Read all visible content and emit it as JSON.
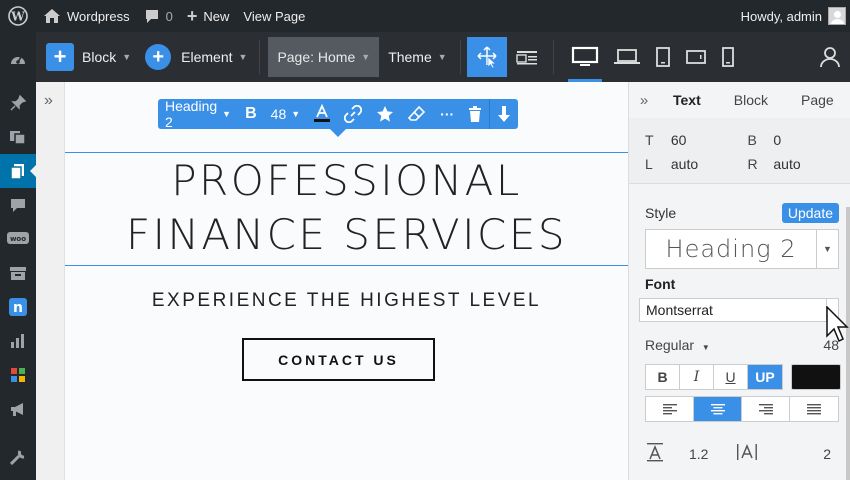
{
  "adminbar": {
    "site_name": "Wordpress",
    "comments_count": "0",
    "new_label": "New",
    "view_page_label": "View Page",
    "howdy": "Howdy, admin"
  },
  "sidebar": {
    "icons": [
      "dashboard-icon",
      "pin-icon",
      "media-icon",
      "pages-icon",
      "comments-icon",
      "woocommerce-icon",
      "archive-icon",
      "n-plugin-icon",
      "stats-icon",
      "grid-plugin-icon",
      "megaphone-icon",
      "tools-icon"
    ],
    "active_index": 3
  },
  "toolbar": {
    "block_label": "Block",
    "element_label": "Element",
    "page_label": "Page: Home",
    "theme_label": "Theme"
  },
  "inline_toolbar": {
    "style_label": "Heading 2",
    "bold_label": "B",
    "size_value": "48",
    "more_label": "···"
  },
  "content": {
    "heading_line1": "PROFESSIONAL",
    "heading_line2": "FINANCE SERVICES",
    "subheading": "EXPERIENCE THE HIGHEST LEVEL",
    "cta_label": "CONTACT US"
  },
  "panel": {
    "tabs": [
      "Text",
      "Block",
      "Page"
    ],
    "active_tab": "Text",
    "spacing": {
      "t_label": "T",
      "t_value": "60",
      "b_label": "B",
      "b_value": "0",
      "l_label": "L",
      "l_value": "auto",
      "r_label": "R",
      "r_value": "auto"
    },
    "style_label": "Style",
    "update_label": "Update",
    "style_value": "Heading 2",
    "font_label": "Font",
    "font_value": "Montserrat",
    "weight_label": "Regular",
    "size_value": "48",
    "format": {
      "bold": "B",
      "italic": "I",
      "underline": "U",
      "uppercase": "UP"
    },
    "text_color": "#111111",
    "line_height": "1.2",
    "letter_spacing": "2"
  },
  "colors": {
    "accent": "#3a8fe6",
    "admin_bg": "#23282d",
    "toolbar_bg": "#2b2f33"
  }
}
